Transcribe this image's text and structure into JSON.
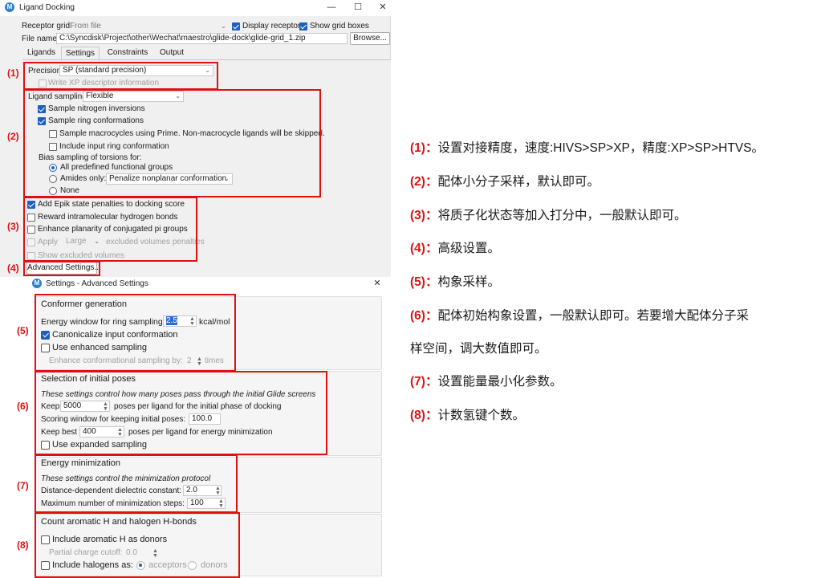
{
  "window": {
    "app_icon": "M",
    "title": "Ligand Docking",
    "minimize": "—",
    "maximize": "☐",
    "close": "✕"
  },
  "receptor": {
    "grid_label": "Receptor grid:",
    "grid_value": "From file",
    "display_receptor": "Display receptor",
    "show_grid_boxes": "Show grid boxes",
    "file_label": "File name:",
    "file_value": "C:\\Syncdisk\\Project\\other\\Wechat\\maestro\\glide-dock\\glide-grid_1.zip",
    "browse": "Browse..."
  },
  "tabs": [
    "Ligands",
    "Settings",
    "Constraints",
    "Output"
  ],
  "settings": {
    "precision_label": "Precision:",
    "precision_value": "SP (standard precision)",
    "write_xp": "Write XP descriptor information",
    "sampling_label": "Ligand sampling:",
    "sampling_value": "Flexible",
    "nitrogen": "Sample nitrogen inversions",
    "ring": "Sample ring conformations",
    "macrocycles": "Sample macrocycles using Prime. Non-macrocycle ligands will be skipped.",
    "include_ring": "Include input ring conformation",
    "bias_label": "Bias sampling of torsions for:",
    "all_groups": "All predefined functional groups",
    "amides_only": "Amides only:",
    "amides_value": "Penalize nonplanar conformation",
    "none": "None",
    "epik": "Add Epik state penalties to docking score",
    "reward_hbond": "Reward intramolecular hydrogen bonds",
    "planarity": "Enhance planarity of conjugated pi groups",
    "apply": "Apply",
    "large": "Large",
    "excluded_penalties": "excluded volumes penalties",
    "show_excluded": "Show excluded volumes",
    "advanced": "Advanced Settings..."
  },
  "advanced": {
    "app_icon": "M",
    "title": "Settings - Advanced Settings",
    "close": "✕",
    "conformer": {
      "title": "Conformer generation",
      "energy_label": "Energy window for ring sampling:",
      "energy_value": "2.5",
      "energy_unit": "kcal/mol",
      "canonicalize": "Canonicalize input conformation",
      "enhanced": "Use enhanced sampling",
      "enhance_label": "Enhance conformational sampling by:",
      "enhance_value": "2",
      "enhance_unit": "times"
    },
    "poses": {
      "title": "Selection of initial poses",
      "desc": "These settings control how many poses pass through the initial Glide screens",
      "keep_label": "Keep",
      "keep_value": "5000",
      "keep_suffix": "poses per ligand for the initial phase of docking",
      "scoring_label": "Scoring window for keeping initial poses:",
      "scoring_value": "100.0",
      "best_label": "Keep best",
      "best_value": "400",
      "best_suffix": "poses per ligand for energy minimization",
      "expanded": "Use expanded sampling"
    },
    "minimization": {
      "title": "Energy minimization",
      "desc": "These settings control the minimization protocol",
      "dielectric_label": "Distance-dependent dielectric constant:",
      "dielectric_value": "2.0",
      "steps_label": "Maximum number of minimization steps:",
      "steps_value": "100"
    },
    "hbonds": {
      "title": "Count aromatic H and halogen H-bonds",
      "aromatic": "Include aromatic H as donors",
      "cutoff_label": "Partial charge cutoff:",
      "cutoff_value": "0.0",
      "halogens": "Include halogens as:",
      "acceptors": "acceptors",
      "donors": "donors"
    }
  },
  "markers": [
    "(1)",
    "(2)",
    "(3)",
    "(4)",
    "(5)",
    "(6)",
    "(7)",
    "(8)"
  ],
  "notes": [
    {
      "key": "(1)：",
      "text": "设置对接精度，速度:HIVS>SP>XP，精度:XP>SP>HTVS。"
    },
    {
      "key": "(2)：",
      "text": "配体小分子采样，默认即可。"
    },
    {
      "key": "(3)：",
      "text": "将质子化状态等加入打分中，一般默认即可。"
    },
    {
      "key": "(4)：",
      "text": "高级设置。"
    },
    {
      "key": "(5)：",
      "text": "构象采样。"
    },
    {
      "key": "(6)：",
      "text": "配体初始构象设置，一般默认即可。若要增大配体分子采"
    },
    {
      "key": "",
      "text": "样空间，调大数值即可。"
    },
    {
      "key": "(7)：",
      "text": "设置能量最小化参数。"
    },
    {
      "key": "(8)：",
      "text": "计数氢键个数。"
    }
  ],
  "colors": {
    "annotation_red": "#e01010",
    "accent_blue": "#1e5fbe"
  }
}
